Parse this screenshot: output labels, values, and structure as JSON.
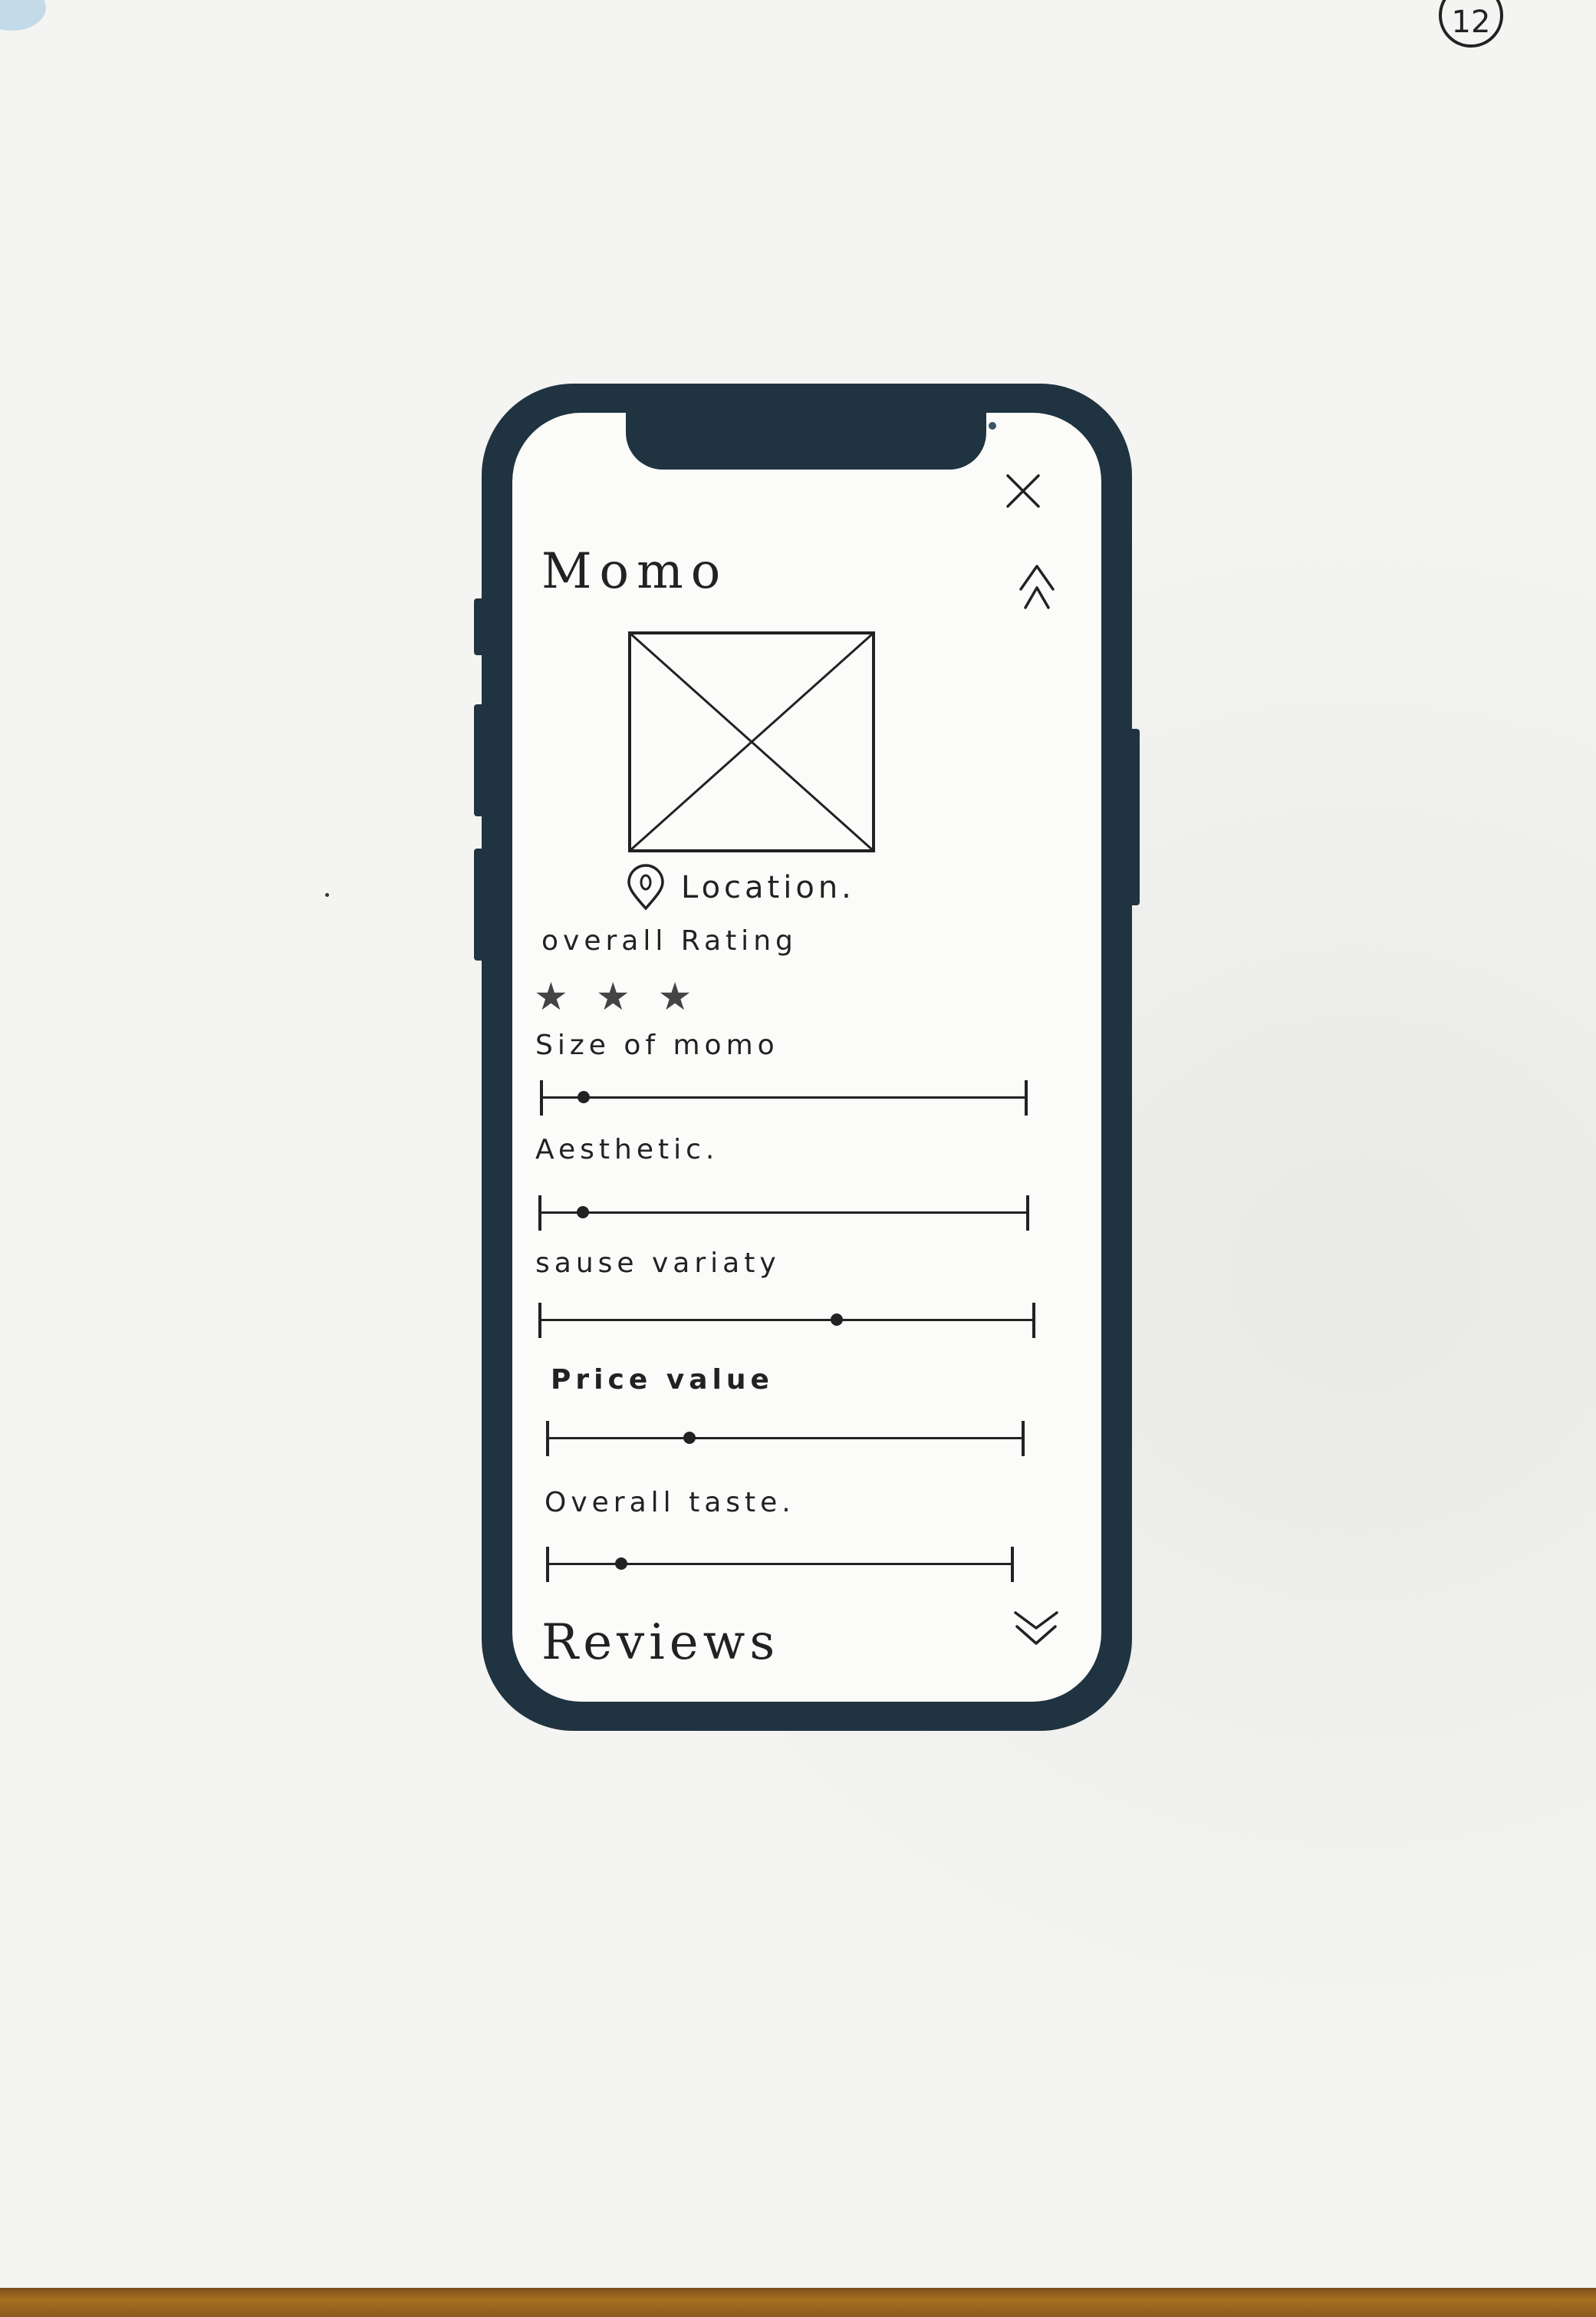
{
  "page_number": "12",
  "app": {
    "title": "Momo",
    "location_label": "Location.",
    "overall_rating_label": "overall Rating",
    "overall_rating_stars": 3,
    "star_glyph": "★",
    "reviews_heading": "Reviews"
  },
  "sliders": [
    {
      "label": "Size of momo",
      "value": 0.09
    },
    {
      "label": "Aesthetic.",
      "value": 0.09
    },
    {
      "label": "sause variaty",
      "value": 0.6
    },
    {
      "label": "Price value",
      "value": 0.3
    },
    {
      "label": "Overall taste.",
      "value": 0.16
    }
  ],
  "icons": {
    "close": "close-icon",
    "collapse": "double-chevron-up-icon",
    "image": "image-placeholder-icon",
    "location": "location-pin-icon",
    "expand": "double-chevron-down-icon"
  },
  "colors": {
    "phone_frame": "#1f3340",
    "screen": "#fbfbfa",
    "ink": "#222222"
  }
}
